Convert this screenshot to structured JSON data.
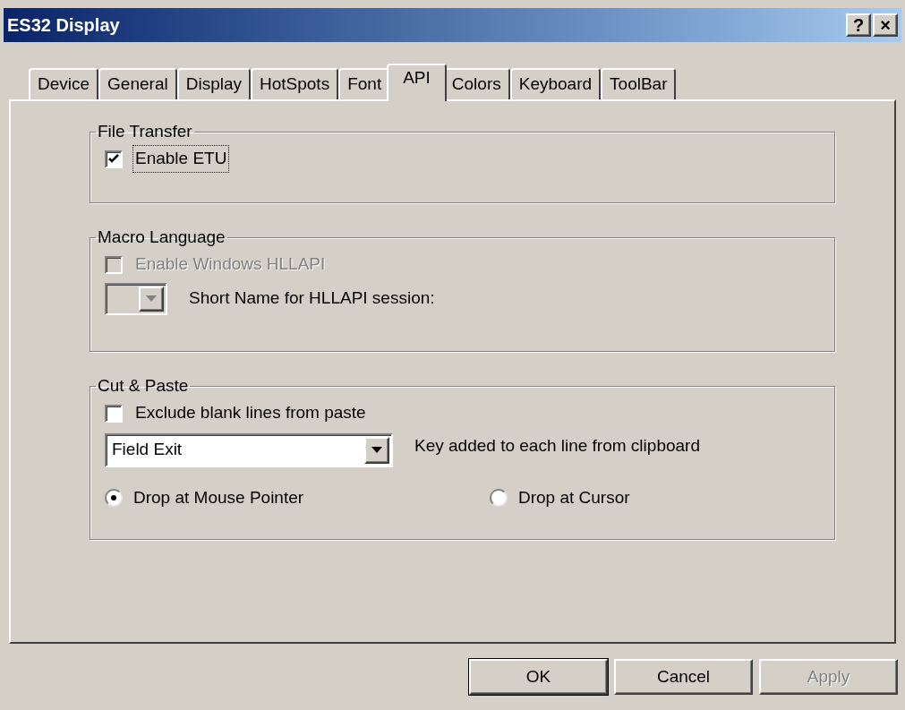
{
  "window": {
    "title": "ES32 Display",
    "title_buttons": [
      "?",
      "×"
    ]
  },
  "tabs": [
    {
      "label": "Device",
      "selected": false
    },
    {
      "label": "General",
      "selected": false
    },
    {
      "label": "Display",
      "selected": false
    },
    {
      "label": "HotSpots",
      "selected": false
    },
    {
      "label": "Font",
      "selected": false
    },
    {
      "label": "API",
      "selected": true
    },
    {
      "label": "Colors",
      "selected": false
    },
    {
      "label": "Keyboard",
      "selected": false
    },
    {
      "label": "ToolBar",
      "selected": false
    }
  ],
  "groups": [
    {
      "title": "File Transfer",
      "items": [
        {
          "kind": "checkbox",
          "label": "Enable ETU",
          "checked": true,
          "disabled": false,
          "focused": true
        }
      ]
    },
    {
      "title": "Macro Language",
      "items": [
        {
          "kind": "checkbox",
          "label": "Enable Windows HLLAPI",
          "checked": false,
          "disabled": true,
          "focused": false
        },
        {
          "kind": "small_combo",
          "label": "Short Name for HLLAPI session:",
          "disabled": true
        }
      ]
    },
    {
      "title": "Cut & Paste",
      "items": [
        {
          "kind": "checkbox",
          "label": "Exclude blank lines from paste",
          "checked": false,
          "disabled": false,
          "focused": false
        },
        {
          "kind": "dropdown",
          "label": "Key added to each line from clipboard",
          "selected_option": "Field Exit"
        },
        {
          "kind": "radios",
          "options": [
            {
              "label": "Drop at Mouse Pointer",
              "selected": true
            },
            {
              "label": "Drop at Cursor",
              "selected": false
            }
          ]
        }
      ]
    }
  ],
  "buttons": [
    {
      "label": "OK",
      "default": true,
      "disabled": false
    },
    {
      "label": "Cancel",
      "default": false,
      "disabled": false
    },
    {
      "label": "Apply",
      "default": false,
      "disabled": true
    }
  ]
}
